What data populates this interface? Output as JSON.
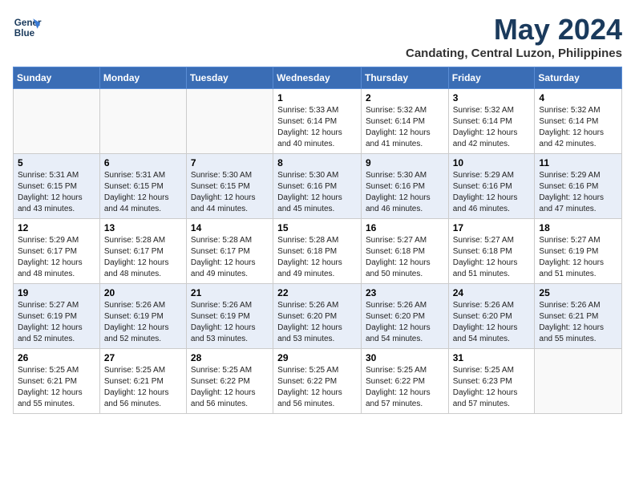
{
  "header": {
    "logo_line1": "General",
    "logo_line2": "Blue",
    "month_year": "May 2024",
    "location": "Candating, Central Luzon, Philippines"
  },
  "weekdays": [
    "Sunday",
    "Monday",
    "Tuesday",
    "Wednesday",
    "Thursday",
    "Friday",
    "Saturday"
  ],
  "weeks": [
    [
      {
        "day": "",
        "info": ""
      },
      {
        "day": "",
        "info": ""
      },
      {
        "day": "",
        "info": ""
      },
      {
        "day": "1",
        "info": "Sunrise: 5:33 AM\nSunset: 6:14 PM\nDaylight: 12 hours\nand 40 minutes."
      },
      {
        "day": "2",
        "info": "Sunrise: 5:32 AM\nSunset: 6:14 PM\nDaylight: 12 hours\nand 41 minutes."
      },
      {
        "day": "3",
        "info": "Sunrise: 5:32 AM\nSunset: 6:14 PM\nDaylight: 12 hours\nand 42 minutes."
      },
      {
        "day": "4",
        "info": "Sunrise: 5:32 AM\nSunset: 6:14 PM\nDaylight: 12 hours\nand 42 minutes."
      }
    ],
    [
      {
        "day": "5",
        "info": "Sunrise: 5:31 AM\nSunset: 6:15 PM\nDaylight: 12 hours\nand 43 minutes."
      },
      {
        "day": "6",
        "info": "Sunrise: 5:31 AM\nSunset: 6:15 PM\nDaylight: 12 hours\nand 44 minutes."
      },
      {
        "day": "7",
        "info": "Sunrise: 5:30 AM\nSunset: 6:15 PM\nDaylight: 12 hours\nand 44 minutes."
      },
      {
        "day": "8",
        "info": "Sunrise: 5:30 AM\nSunset: 6:16 PM\nDaylight: 12 hours\nand 45 minutes."
      },
      {
        "day": "9",
        "info": "Sunrise: 5:30 AM\nSunset: 6:16 PM\nDaylight: 12 hours\nand 46 minutes."
      },
      {
        "day": "10",
        "info": "Sunrise: 5:29 AM\nSunset: 6:16 PM\nDaylight: 12 hours\nand 46 minutes."
      },
      {
        "day": "11",
        "info": "Sunrise: 5:29 AM\nSunset: 6:16 PM\nDaylight: 12 hours\nand 47 minutes."
      }
    ],
    [
      {
        "day": "12",
        "info": "Sunrise: 5:29 AM\nSunset: 6:17 PM\nDaylight: 12 hours\nand 48 minutes."
      },
      {
        "day": "13",
        "info": "Sunrise: 5:28 AM\nSunset: 6:17 PM\nDaylight: 12 hours\nand 48 minutes."
      },
      {
        "day": "14",
        "info": "Sunrise: 5:28 AM\nSunset: 6:17 PM\nDaylight: 12 hours\nand 49 minutes."
      },
      {
        "day": "15",
        "info": "Sunrise: 5:28 AM\nSunset: 6:18 PM\nDaylight: 12 hours\nand 49 minutes."
      },
      {
        "day": "16",
        "info": "Sunrise: 5:27 AM\nSunset: 6:18 PM\nDaylight: 12 hours\nand 50 minutes."
      },
      {
        "day": "17",
        "info": "Sunrise: 5:27 AM\nSunset: 6:18 PM\nDaylight: 12 hours\nand 51 minutes."
      },
      {
        "day": "18",
        "info": "Sunrise: 5:27 AM\nSunset: 6:19 PM\nDaylight: 12 hours\nand 51 minutes."
      }
    ],
    [
      {
        "day": "19",
        "info": "Sunrise: 5:27 AM\nSunset: 6:19 PM\nDaylight: 12 hours\nand 52 minutes."
      },
      {
        "day": "20",
        "info": "Sunrise: 5:26 AM\nSunset: 6:19 PM\nDaylight: 12 hours\nand 52 minutes."
      },
      {
        "day": "21",
        "info": "Sunrise: 5:26 AM\nSunset: 6:19 PM\nDaylight: 12 hours\nand 53 minutes."
      },
      {
        "day": "22",
        "info": "Sunrise: 5:26 AM\nSunset: 6:20 PM\nDaylight: 12 hours\nand 53 minutes."
      },
      {
        "day": "23",
        "info": "Sunrise: 5:26 AM\nSunset: 6:20 PM\nDaylight: 12 hours\nand 54 minutes."
      },
      {
        "day": "24",
        "info": "Sunrise: 5:26 AM\nSunset: 6:20 PM\nDaylight: 12 hours\nand 54 minutes."
      },
      {
        "day": "25",
        "info": "Sunrise: 5:26 AM\nSunset: 6:21 PM\nDaylight: 12 hours\nand 55 minutes."
      }
    ],
    [
      {
        "day": "26",
        "info": "Sunrise: 5:25 AM\nSunset: 6:21 PM\nDaylight: 12 hours\nand 55 minutes."
      },
      {
        "day": "27",
        "info": "Sunrise: 5:25 AM\nSunset: 6:21 PM\nDaylight: 12 hours\nand 56 minutes."
      },
      {
        "day": "28",
        "info": "Sunrise: 5:25 AM\nSunset: 6:22 PM\nDaylight: 12 hours\nand 56 minutes."
      },
      {
        "day": "29",
        "info": "Sunrise: 5:25 AM\nSunset: 6:22 PM\nDaylight: 12 hours\nand 56 minutes."
      },
      {
        "day": "30",
        "info": "Sunrise: 5:25 AM\nSunset: 6:22 PM\nDaylight: 12 hours\nand 57 minutes."
      },
      {
        "day": "31",
        "info": "Sunrise: 5:25 AM\nSunset: 6:23 PM\nDaylight: 12 hours\nand 57 minutes."
      },
      {
        "day": "",
        "info": ""
      }
    ]
  ]
}
